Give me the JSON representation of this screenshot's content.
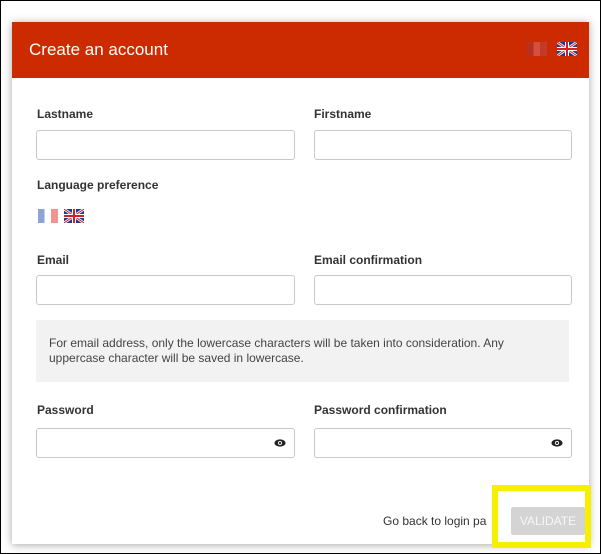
{
  "header": {
    "title": "Create an account",
    "flags": [
      "flag-fr-icon",
      "flag-uk-icon"
    ],
    "accent_color": "#cc2a00"
  },
  "form": {
    "lastname_label": "Lastname",
    "firstname_label": "Firstname",
    "language_label": "Language preference",
    "language_options": [
      "flag-fr-icon",
      "flag-uk-icon"
    ],
    "email_label": "Email",
    "email_confirmation_label": "Email confirmation",
    "info_text": "For email address, only the lowercase characters will be taken into consideration. Any uppercase character will be saved in lowercase.",
    "password_label": "Password",
    "password_confirmation_label": "Password confirmation",
    "lastname_value": "",
    "firstname_value": "",
    "email_value": "",
    "email_confirmation_value": "",
    "password_value": "",
    "password_confirmation_value": ""
  },
  "footer": {
    "back_link": "Go back to login pa",
    "validate_label": "VALIDATE"
  },
  "highlight_color": "#f6f000"
}
